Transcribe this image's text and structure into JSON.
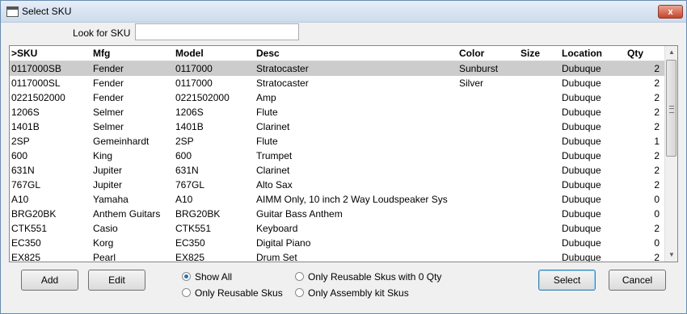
{
  "window": {
    "title": "Select SKU",
    "close_label": "x"
  },
  "search": {
    "label": "Look for SKU",
    "value": ""
  },
  "grid": {
    "headers": {
      "sku": ">SKU",
      "mfg": "Mfg",
      "model": "Model",
      "desc": "Desc",
      "color": "Color",
      "size": "Size",
      "location": "Location",
      "qty": "Qty"
    },
    "rows": [
      {
        "sku": "0117000SB",
        "mfg": "Fender",
        "model": "0117000",
        "desc": "Stratocaster",
        "color": "Sunburst",
        "size": "",
        "location": "Dubuque",
        "qty": "2"
      },
      {
        "sku": "0117000SL",
        "mfg": "Fender",
        "model": "0117000",
        "desc": "Stratocaster",
        "color": "Silver",
        "size": "",
        "location": "Dubuque",
        "qty": "2"
      },
      {
        "sku": "0221502000",
        "mfg": "Fender",
        "model": "0221502000",
        "desc": "Amp",
        "color": "",
        "size": "",
        "location": "Dubuque",
        "qty": "2"
      },
      {
        "sku": "1206S",
        "mfg": "Selmer",
        "model": "1206S",
        "desc": "Flute",
        "color": "",
        "size": "",
        "location": "Dubuque",
        "qty": "2"
      },
      {
        "sku": "1401B",
        "mfg": "Selmer",
        "model": "1401B",
        "desc": "Clarinet",
        "color": "",
        "size": "",
        "location": "Dubuque",
        "qty": "2"
      },
      {
        "sku": "2SP",
        "mfg": "Gemeinhardt",
        "model": "2SP",
        "desc": "Flute",
        "color": "",
        "size": "",
        "location": "Dubuque",
        "qty": "1"
      },
      {
        "sku": "600",
        "mfg": "King",
        "model": "600",
        "desc": "Trumpet",
        "color": "",
        "size": "",
        "location": "Dubuque",
        "qty": "2"
      },
      {
        "sku": "631N",
        "mfg": "Jupiter",
        "model": "631N",
        "desc": "Clarinet",
        "color": "",
        "size": "",
        "location": "Dubuque",
        "qty": "2"
      },
      {
        "sku": "767GL",
        "mfg": "Jupiter",
        "model": "767GL",
        "desc": "Alto Sax",
        "color": "",
        "size": "",
        "location": "Dubuque",
        "qty": "2"
      },
      {
        "sku": "A10",
        "mfg": "Yamaha",
        "model": "A10",
        "desc": "AIMM Only, 10 inch 2 Way Loudspeaker Sys",
        "color": "",
        "size": "",
        "location": "Dubuque",
        "qty": "0"
      },
      {
        "sku": "BRG20BK",
        "mfg": "Anthem Guitars",
        "model": "BRG20BK",
        "desc": "Guitar Bass Anthem",
        "color": "",
        "size": "",
        "location": "Dubuque",
        "qty": "0"
      },
      {
        "sku": "CTK551",
        "mfg": "Casio",
        "model": "CTK551",
        "desc": "Keyboard",
        "color": "",
        "size": "",
        "location": "Dubuque",
        "qty": "2"
      },
      {
        "sku": "EC350",
        "mfg": "Korg",
        "model": "EC350",
        "desc": "Digital Piano",
        "color": "",
        "size": "",
        "location": "Dubuque",
        "qty": "0"
      },
      {
        "sku": "EX825",
        "mfg": "Pearl",
        "model": "EX825",
        "desc": "Drum Set",
        "color": "",
        "size": "",
        "location": "Dubuque",
        "qty": "2"
      }
    ]
  },
  "buttons": {
    "add": "Add",
    "edit": "Edit",
    "select": "Select",
    "cancel": "Cancel"
  },
  "filters": {
    "show_all": "Show All",
    "only_reusable": "Only Reusable Skus",
    "reusable_zero": "Only Reusable Skus with 0 Qty",
    "assembly_kit": "Only Assembly kit Skus",
    "selected": "show_all"
  }
}
